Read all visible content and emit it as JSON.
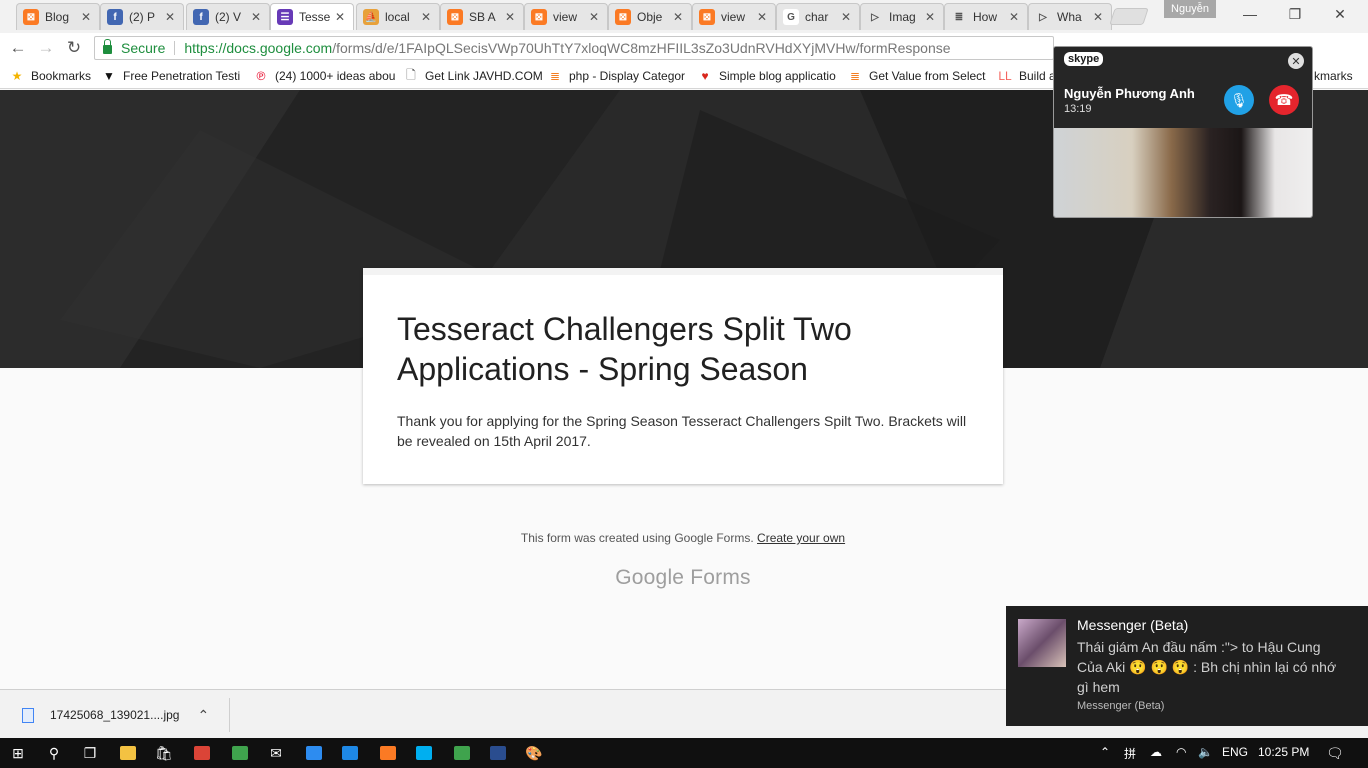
{
  "tabs": [
    {
      "title": "Blog",
      "icon": "xampp-icon",
      "color": "#fb7a24",
      "glyph": "⊠"
    },
    {
      "title": "(2) P",
      "icon": "facebook-icon",
      "color": "#4267b2",
      "glyph": "f"
    },
    {
      "title": "(2) V",
      "icon": "facebook-icon",
      "color": "#4267b2",
      "glyph": "f"
    },
    {
      "title": "Tesse",
      "icon": "google-forms-icon",
      "color": "#673ab7",
      "glyph": "☰"
    },
    {
      "title": "local",
      "icon": "phpmyadmin-icon",
      "color": "#e8a13a",
      "glyph": "⛵"
    },
    {
      "title": "SB A",
      "icon": "xampp-icon",
      "color": "#fb7a24",
      "glyph": "⊠"
    },
    {
      "title": "view",
      "icon": "xampp-icon",
      "color": "#fb7a24",
      "glyph": "⊠"
    },
    {
      "title": "Obje",
      "icon": "xampp-icon",
      "color": "#fb7a24",
      "glyph": "⊠"
    },
    {
      "title": "view",
      "icon": "xampp-icon",
      "color": "#fb7a24",
      "glyph": "⊠"
    },
    {
      "title": "char",
      "icon": "google-icon",
      "color": "#ffffff",
      "glyph": "G"
    },
    {
      "title": "Imag",
      "icon": "arrow-icon",
      "color": "#e6e6e6",
      "glyph": "▷"
    },
    {
      "title": "How",
      "icon": "stackoverflow-icon",
      "color": "#e6e6e6",
      "glyph": "≣"
    },
    {
      "title": "Wha",
      "icon": "arrow-icon",
      "color": "#e6e6e6",
      "glyph": "▷"
    }
  ],
  "tab_close_glyph": "✕",
  "active_tab_index": 3,
  "profile_name": "Nguyễn",
  "window": {
    "minimize": "—",
    "restore": "❐",
    "close": "✕"
  },
  "address": {
    "secure_label": "Secure",
    "url_host": "https://docs.google.com",
    "url_path": "/forms/d/e/1FAIpQLSecisVWp70UhTtY7xloqWC8mzHFIIL3sZo3UdnRVHdXYjMVHw/formResponse"
  },
  "bookmarks": [
    {
      "label": "Bookmarks",
      "icon": "star-icon",
      "glyph": "★",
      "color": "#f4b400"
    },
    {
      "label": "Free Penetration Testi",
      "icon": "wing-icon",
      "glyph": "▼",
      "color": "#111111"
    },
    {
      "label": "(24) 1000+ ideas abou",
      "icon": "pinterest-icon",
      "glyph": "℗",
      "color": "#e60023"
    },
    {
      "label": "Get Link JAVHD.COM",
      "icon": "page-icon",
      "glyph": "🗋",
      "color": "#555555"
    },
    {
      "label": "php - Display Categor",
      "icon": "stackoverflow-icon",
      "glyph": "≣",
      "color": "#f48024"
    },
    {
      "label": "Simple blog applicatio",
      "icon": "shield-icon",
      "glyph": "♥",
      "color": "#d9261c"
    },
    {
      "label": "Get Value from Select",
      "icon": "stackoverflow-icon",
      "glyph": "≣",
      "color": "#f48024"
    },
    {
      "label": "Build a",
      "icon": "laravel-icon",
      "glyph": "LL",
      "color": "#f4645f"
    }
  ],
  "bookmarks_overflow": "kmarks",
  "form": {
    "title": "Tesseract Challengers Split Two Applications - Spring Season",
    "message": "Thank you for applying for the Spring Season Tesseract Challengers Spilt Two. Brackets will be revealed on 15th April 2017.",
    "footer_text": "This form was created using Google Forms.",
    "footer_link": "Create your own",
    "logo_google": "Google",
    "logo_forms": "Forms"
  },
  "download": {
    "filename": "17425068_139021....jpg",
    "chevron": "⌃"
  },
  "skype": {
    "logo": "skype",
    "caller": "Nguyễn Phương Anh",
    "duration": "13:19",
    "close_glyph": "✕",
    "mic_glyph": "🎙",
    "hangup_glyph": "☎"
  },
  "messenger_toast": {
    "title": "Messenger (Beta)",
    "body": "Thái giám An đầu nấm :\"> to Hậu Cung Của Aki 😲 😲 😲 : Bh chị nhìn lại có nhớ gì hem",
    "source": "Messenger (Beta)"
  },
  "taskbar": {
    "language": "ENG",
    "time": "10:25 PM",
    "apps": [
      {
        "name": "start-button",
        "glyph": "⊞",
        "color": "#ffffff"
      },
      {
        "name": "search-icon",
        "glyph": "⚲",
        "color": "#ffffff"
      },
      {
        "name": "task-view-icon",
        "glyph": "❐",
        "color": "#ffffff"
      },
      {
        "name": "file-explorer-icon",
        "glyph": "",
        "color": "#f3c242"
      },
      {
        "name": "store-icon",
        "glyph": "🛍",
        "color": "#ffffff"
      },
      {
        "name": "chrome-icon",
        "glyph": "",
        "color": "#db4437"
      },
      {
        "name": "app-green-icon",
        "glyph": "",
        "color": "#3fa34d"
      },
      {
        "name": "mail-icon",
        "glyph": "✉",
        "color": "#ffffff"
      },
      {
        "name": "app-blue-icon",
        "glyph": "",
        "color": "#2d8cf0"
      },
      {
        "name": "messenger-icon",
        "glyph": "",
        "color": "#1e88e5"
      },
      {
        "name": "xampp-icon",
        "glyph": "",
        "color": "#fb7a24"
      },
      {
        "name": "skype-icon",
        "glyph": "",
        "color": "#00aff0"
      },
      {
        "name": "app-green-2-icon",
        "glyph": "",
        "color": "#3fa34d"
      },
      {
        "name": "powershell-icon",
        "glyph": "",
        "color": "#2a4d8f"
      },
      {
        "name": "paint-icon",
        "glyph": "🎨",
        "color": "#ffffff"
      }
    ],
    "tray": [
      {
        "name": "tray-chevron-icon",
        "glyph": "⌃"
      },
      {
        "name": "ime-icon",
        "glyph": "拼"
      },
      {
        "name": "onedrive-icon",
        "glyph": "☁"
      },
      {
        "name": "wifi-icon",
        "glyph": "◠"
      },
      {
        "name": "volume-icon",
        "glyph": "🔈"
      }
    ],
    "notification_glyph": "🗨"
  }
}
